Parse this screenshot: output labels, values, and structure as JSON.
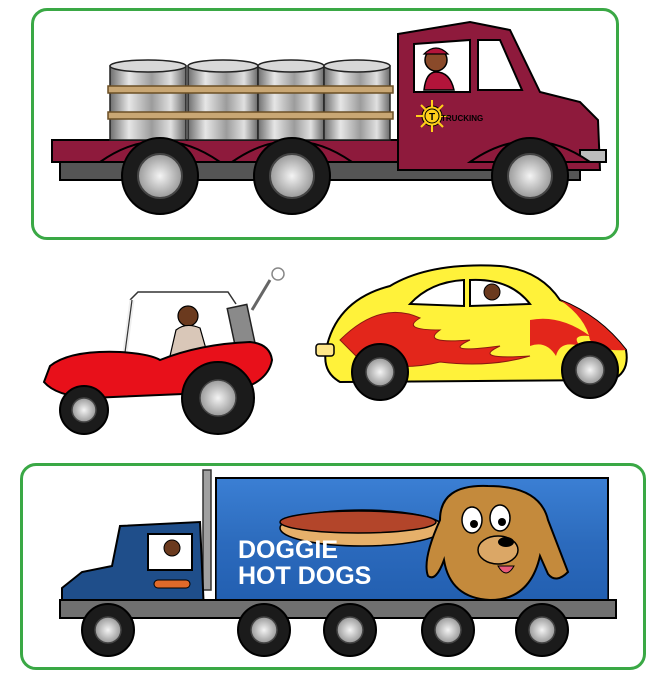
{
  "trucking_logo": {
    "letter": "T",
    "text": "TRUCKING"
  },
  "hotdog_truck": {
    "line1": "DOGGIE",
    "line2": "HOT DOGS"
  },
  "colors": {
    "panel_border": "#3aa845",
    "truck_red": "#8e1a3c",
    "buggy_red": "#e8101a",
    "beetle_yellow": "#fff23a",
    "flame_red": "#e3261b",
    "trailer_blue": "#2f6fc4",
    "cab_blue": "#1f4e8a"
  }
}
